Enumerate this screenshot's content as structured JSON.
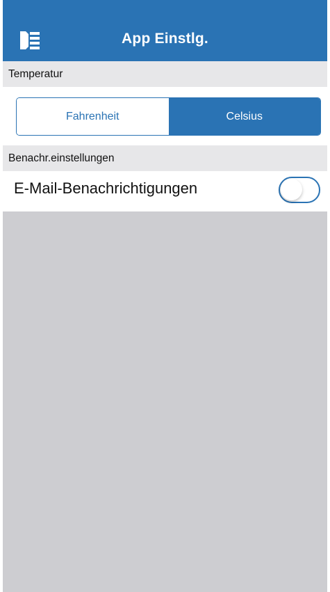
{
  "header": {
    "title": "App Einstlg.",
    "menu_icon": "menu-panel-icon"
  },
  "temperature": {
    "section_label": "Temperatur",
    "options": [
      "Fahrenheit",
      "Celsius"
    ],
    "selected": "Celsius"
  },
  "notifications": {
    "section_label": "Benachr.einstellungen",
    "email_label": "E-Mail-Benachrichtigungen",
    "email_enabled": false
  },
  "colors": {
    "accent": "#2a73b4",
    "background": "#cdcdd1",
    "section_header": "#e7e7e9"
  }
}
